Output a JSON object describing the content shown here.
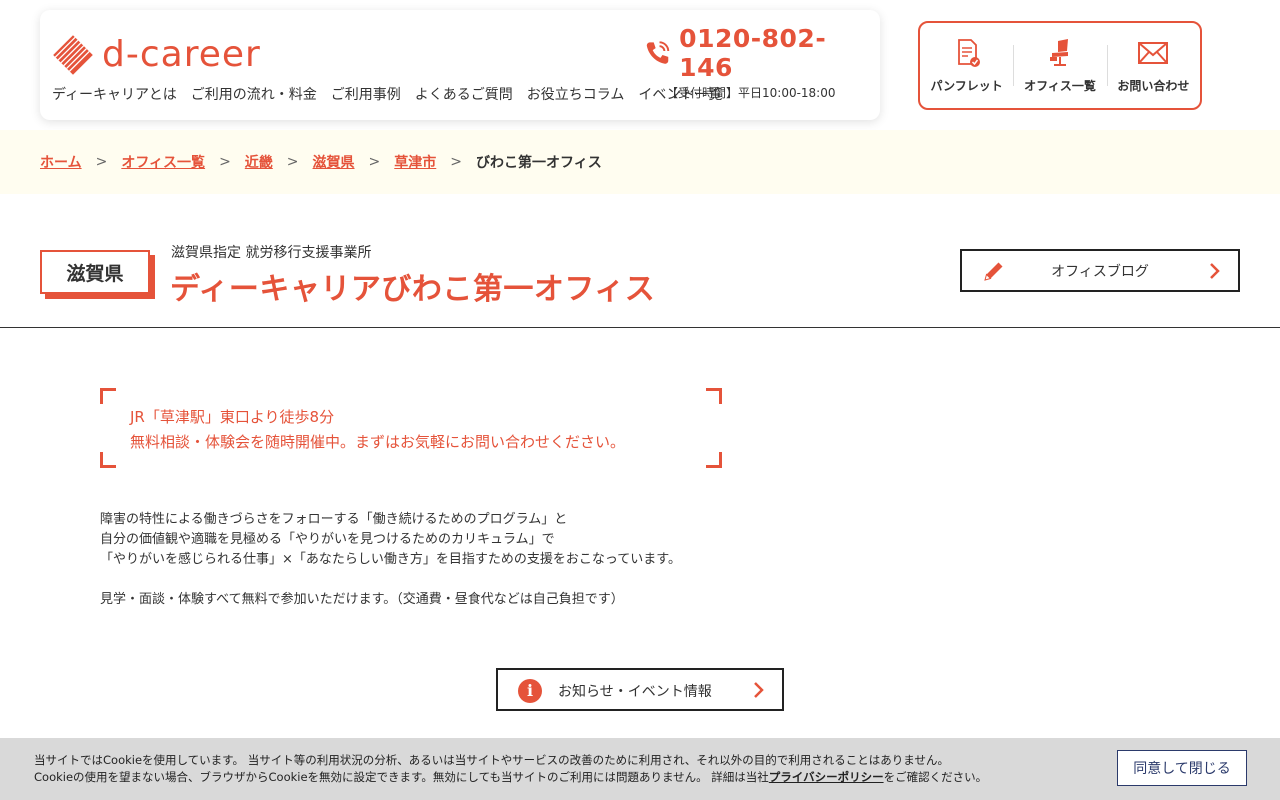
{
  "header": {
    "logo_text": "d-career",
    "nav": [
      "ディーキャリアとは",
      "ご利用の流れ・料金",
      "ご利用事例",
      "よくあるご質問",
      "お役立ちコラム",
      "イベント一覧"
    ],
    "phone_number": "0120-802-146",
    "phone_hours": "【受付時間】平日10:00-18:00",
    "utility": [
      {
        "label": "パンフレット",
        "icon": "pamphlet-icon"
      },
      {
        "label": "オフィス一覧",
        "icon": "office-chair-icon"
      },
      {
        "label": "お問い合わせ",
        "icon": "mail-icon"
      }
    ]
  },
  "breadcrumb": {
    "links": [
      "ホーム",
      "オフィス一覧",
      "近畿",
      "滋賀県",
      "草津市"
    ],
    "separator": ">",
    "current": "びわこ第一オフィス"
  },
  "office": {
    "prefecture": "滋賀県",
    "subtitle": "滋賀県指定 就労移行支援事業所",
    "title": "ディーキャリアびわこ第一オフィス",
    "blog_label": "オフィスブログ"
  },
  "highlight": {
    "line1": "JR「草津駅」東口より徒歩8分",
    "line2": "無料相談・体験会を随時開催中。まずはお気軽にお問い合わせください。"
  },
  "description": {
    "line1": "障害の特性による働きづらさをフォローする「働き続けるためのプログラム」と",
    "line2": "自分の価値観や適職を見極める「やりがいを見つけるためのカリキュラム」で",
    "line3": "「やりがいを感じられる仕事」×「あなたらしい働き方」を目指すための支援をおこなっています。",
    "line4": "見学・面談・体験すべて無料で参加いただけます。（交通費・昼食代などは自己負担です）"
  },
  "news_button": {
    "icon_text": "i",
    "label": "お知らせ・イベント情報"
  },
  "cookie": {
    "line1": "当サイトではCookieを使用しています。 当サイト等の利用状況の分析、あるいは当サイトやサービスの改善のために利用され、それ以外の目的で利用されることはありません。",
    "line2_before": "Cookieの使用を望まない場合、ブラウザからCookieを無効に設定できます。無効にしても当サイトのご利用には問題ありません。 詳細は当社",
    "line2_link": "プライバシーポリシー",
    "line2_after": "をご確認ください。",
    "button": "同意して閉じる"
  },
  "colors": {
    "accent": "#e5533a",
    "breadcrumb_bg": "#fffdf0",
    "cookie_bg": "#d9d9d9",
    "cookie_button": "#2b3a6b"
  }
}
